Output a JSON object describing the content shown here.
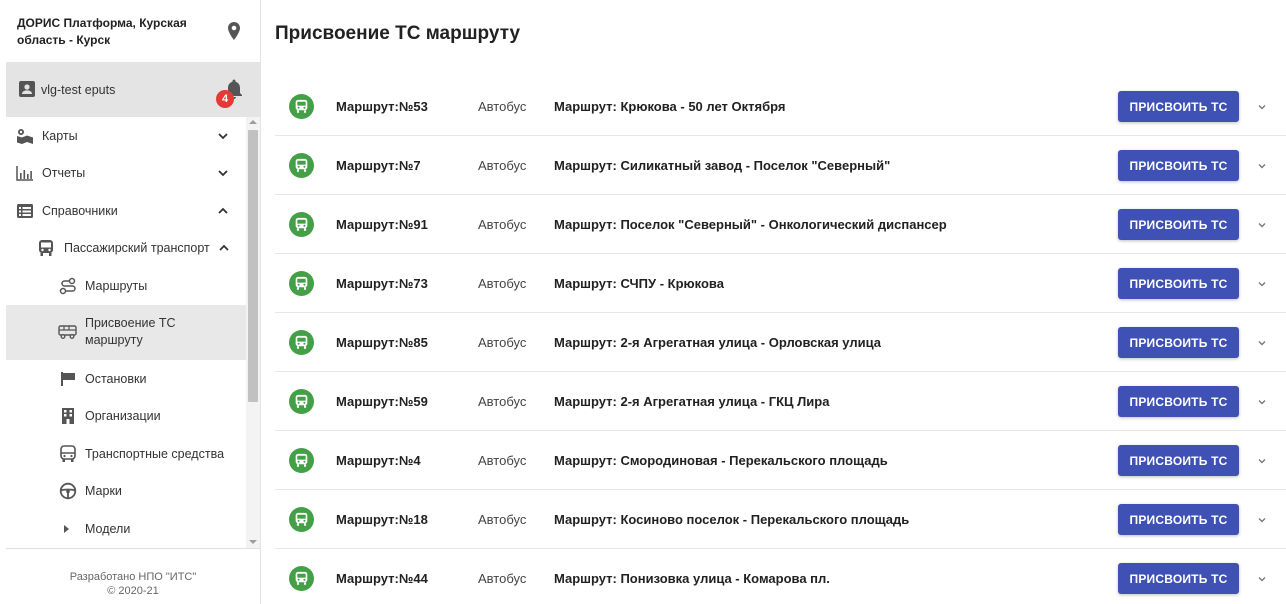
{
  "org": {
    "title": "ДОРИС Платформа, Курская область - Курск"
  },
  "user": {
    "name": "vlg-test eputs",
    "notifications": "4"
  },
  "nav": {
    "items": [
      {
        "label": "Карты",
        "icon": "map-icon"
      },
      {
        "label": "Отчеты",
        "icon": "chart-icon"
      },
      {
        "label": "Справочники",
        "icon": "list-icon"
      },
      {
        "label": "Пассажирский транспорт",
        "icon": "bus-icon"
      },
      {
        "label": "Маршруты",
        "icon": "route-icon"
      },
      {
        "label": "Присвоение ТС маршруту",
        "icon": "bus-outline-icon"
      },
      {
        "label": "Остановки",
        "icon": "stop-icon"
      },
      {
        "label": "Организации",
        "icon": "building-icon"
      },
      {
        "label": "Транспортные средства",
        "icon": "bus-icon"
      },
      {
        "label": "Марки",
        "icon": "steering-icon"
      },
      {
        "label": "Модели",
        "icon": "arrow-right-icon"
      }
    ]
  },
  "footer": {
    "line1": "Разработано НПО \"ИТС\"",
    "line2": "© 2020-21"
  },
  "main": {
    "title": "Присвоение ТС маршруту",
    "assign_label": "ПРИСВОИТЬ ТС",
    "routes": [
      {
        "num": "Маршрут:№53",
        "type": "Автобус",
        "name": "Маршрут: Крюкова - 50 лет Октября"
      },
      {
        "num": "Маршрут:№7",
        "type": "Автобус",
        "name": "Маршрут: Силикатный завод - Поселок \"Северный\""
      },
      {
        "num": "Маршрут:№91",
        "type": "Автобус",
        "name": "Маршрут: Поселок \"Северный\" - Онкологический диспансер"
      },
      {
        "num": "Маршрут:№73",
        "type": "Автобус",
        "name": "Маршрут: СЧПУ - Крюкова"
      },
      {
        "num": "Маршрут:№85",
        "type": "Автобус",
        "name": "Маршрут: 2-я Агрегатная улица - Орловская улица"
      },
      {
        "num": "Маршрут:№59",
        "type": "Автобус",
        "name": "Маршрут: 2-я Агрегатная улица - ГКЦ Лира"
      },
      {
        "num": "Маршрут:№4",
        "type": "Автобус",
        "name": "Маршрут: Смородиновая - Перекальского площадь"
      },
      {
        "num": "Маршрут:№18",
        "type": "Автобус",
        "name": "Маршрут: Косиново поселок - Перекальского площадь"
      },
      {
        "num": "Маршрут:№44",
        "type": "Автобус",
        "name": "Маршрут: Понизовка улица - Комарова пл."
      }
    ]
  },
  "colors": {
    "primary": "#3f51b5",
    "bus_icon_bg": "#43a047",
    "badge": "#e53935",
    "active_bg": "#e8e8e8"
  }
}
